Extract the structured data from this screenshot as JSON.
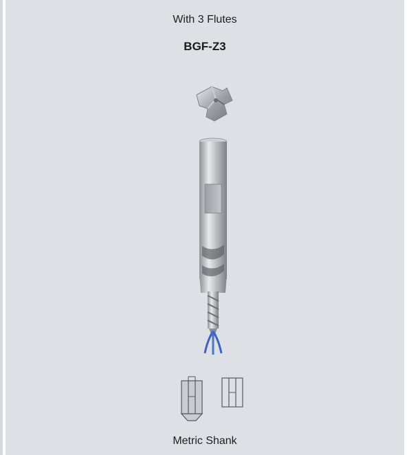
{
  "header": {
    "title": "With 3 Flutes",
    "model": "BGF-Z3"
  },
  "images": {
    "insert": "three-flute-insert-image",
    "tool": "end-mill-holder-image",
    "shank_icons": [
      "shank-with-chamfer-icon",
      "straight-shank-icon"
    ]
  },
  "footer": {
    "caption": "Metric Shank"
  },
  "colors": {
    "panel_background": "#dde1e5",
    "tool_steel": "#a9aeb3",
    "coolant_blue": "#3a63c8"
  }
}
